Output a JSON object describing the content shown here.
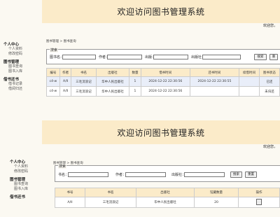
{
  "frame1": {
    "title": "欢迎访问图书管理系统",
    "welcome": "欢迎您，",
    "breadcrumb": "图书管理 > 图书查询",
    "sidebar": [
      {
        "head": "个人中心",
        "items": [
          "个人资料",
          "修改密码"
        ]
      },
      {
        "head": "图书管理",
        "items": [
          "图书查询",
          "图书入库"
        ]
      },
      {
        "head": "借书还书",
        "items": [
          "借书记录",
          "借阅归还"
        ]
      }
    ],
    "search": {
      "legend": "搜索",
      "fields": [
        {
          "label": "图书名：",
          "value": ""
        },
        {
          "label": "作者：",
          "value": ""
        },
        {
          "label": "出版：",
          "value": ""
        },
        {
          "label": "出版社：",
          "value": ""
        }
      ],
      "btn_search": "搜索",
      "btn_reset": "重"
    },
    "table": {
      "headers": [
        "编号",
        "作者",
        "书名",
        "出版社",
        "数量",
        "借书时间",
        "还书时间",
        "续借时间",
        "图书状态"
      ],
      "rows": [
        [
          "c4-w",
          "A/II",
          "三毛流浪记",
          "华中人民出版社",
          "1",
          "2024-12-22 22:30:56",
          "2024-12-22 22:30:55",
          "",
          "已还"
        ],
        [
          "c4-w",
          "A/II",
          "三毛流浪记",
          "华中人民出版社",
          "1",
          "2024-12-22 22:30:56",
          "",
          "",
          "未归还"
        ]
      ]
    }
  },
  "frame2": {
    "title": "欢迎访问图书管理系统",
    "welcome": "欢迎您，",
    "breadcrumb": "图书管理 > 图书查询",
    "sidebar": [
      {
        "head": "个人中心",
        "items": [
          "个人资料",
          "修改密码"
        ]
      },
      {
        "head": "图书管理",
        "items": [
          "图书查询",
          "图书入库"
        ]
      },
      {
        "head": "借书还书",
        "items": []
      }
    ],
    "search": {
      "legend": "搜索",
      "fields": [
        {
          "label": "书名：",
          "value": ""
        },
        {
          "label": "作者：",
          "value": ""
        },
        {
          "label": "出版社：",
          "value": ""
        }
      ],
      "btn_search": "搜索",
      "btn_reset": "重置"
    },
    "table": {
      "headers": [
        "书号",
        "书名",
        "出版社",
        "馆藏数量",
        "操作"
      ],
      "rows": [
        [
          "A/II",
          "三毛流浪记",
          "华中人民出版社",
          "20",
          ""
        ]
      ]
    }
  },
  "colors": {
    "header_bg": "#fbebc9",
    "page_bg": "#fbf9f2",
    "status_ok": "#2a9a2a",
    "status_borrowed": "#c68a00"
  }
}
